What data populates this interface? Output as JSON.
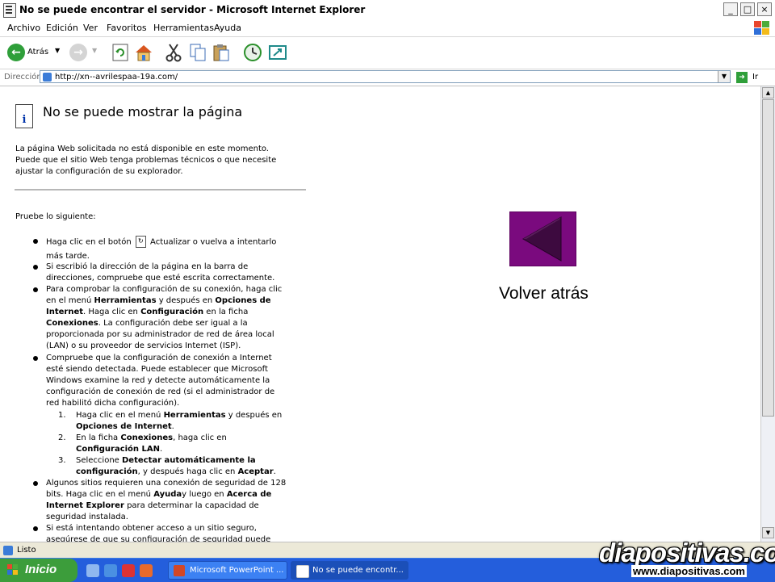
{
  "window": {
    "title": "No se puede encontrar el servidor - Microsoft Internet Explorer",
    "minimize": "_",
    "maximize": "□",
    "close": "×"
  },
  "menubar": {
    "items": [
      "Archivo",
      "Edición",
      "Ver",
      "Favoritos",
      "Herramientas",
      "Ayuda"
    ]
  },
  "toolbar": {
    "back_label": "Atrás"
  },
  "address": {
    "label": "Dirección",
    "url": "http://xn--avrilespaa-19a.com/",
    "go_label": "Ir"
  },
  "page": {
    "heading": "No se puede mostrar la página",
    "intro": [
      "La página Web solicitada no está disponible en este momento.",
      "Puede que el sitio Web tenga problemas técnicos o que necesite",
      "ajustar la configuración de su explorador."
    ],
    "try_label": "Pruebe lo siguiente:",
    "b1": {
      "pre": "Haga clic en el botón",
      "post": "Actualizar o vuelva a intentarlo",
      "line2": "más tarde."
    },
    "b2": [
      "Si escribió la dirección de la página en la barra de",
      "direcciones, compruebe que esté escrita correctamente."
    ],
    "b3": {
      "l1": "Para comprobar la configuración de su conexión, haga clic",
      "l2_pre": "en el menú ",
      "l2_b1": "Herramientas",
      "l2_mid": " y después en ",
      "l2_b2": "Opciones de",
      "l3_b": "Internet",
      "l3_mid": ". Haga clic en ",
      "l3_b2": "Configuración",
      "l3_post": " en la ficha",
      "l4_b": "Conexiones",
      "l4_post": ". La configuración debe ser igual a la",
      "l5": "proporcionada por su administrador de red de área local",
      "l6": "(LAN) o su proveedor de servicios Internet (ISP)."
    },
    "b4": [
      "Compruebe que la configuración de conexión a Internet",
      "esté siendo detectada. Puede establecer que Microsoft",
      "Windows examine la red y detecte automáticamente la",
      "configuración de conexión de red (si el administrador de",
      "red habilitó dicha configuración)."
    ],
    "n1": {
      "num": "1.",
      "pre": "Haga clic en el menú ",
      "b1": "Herramientas",
      "mid": " y después en",
      "b2": "Opciones de Internet",
      "post": "."
    },
    "n2": {
      "num": "2.",
      "pre": "En la ficha ",
      "b1": "Conexiones",
      "mid": ", haga clic en",
      "b2": "Configuración LAN",
      "post": "."
    },
    "n3": {
      "num": "3.",
      "pre": "Seleccione ",
      "b1": "Detectar automáticamente la",
      "b2": "configuración",
      "post": ", y después haga clic en ",
      "b3": "Aceptar",
      "end": "."
    },
    "b5": {
      "l1": "Algunos sitios requieren una conexión de seguridad de 128",
      "l2_pre": "bits. Haga clic en el menú ",
      "l2_b1": "Ayuda",
      "l2_mid": "y luego en ",
      "l2_b2": "Acerca de",
      "l3_b": "Internet Explorer",
      "l3_post": " para determinar la capacidad de",
      "l4": "seguridad instalada."
    },
    "b6": [
      "Si está intentando obtener acceso a un sitio seguro,",
      "asegúrese de que su configuración de seguridad puede"
    ]
  },
  "overlay": {
    "back_label": "Volver atrás",
    "colors": {
      "button": "#7a0a7e",
      "triangle": "#3d0a3f"
    }
  },
  "status": {
    "text": "Listo"
  },
  "taskbar": {
    "start_label": "Inicio",
    "tasks": [
      "Microsoft PowerPoint ...",
      "No se puede encontr..."
    ]
  },
  "watermark": {
    "logo": "diapositivas.com",
    "url": "www.diapositivas.com"
  }
}
